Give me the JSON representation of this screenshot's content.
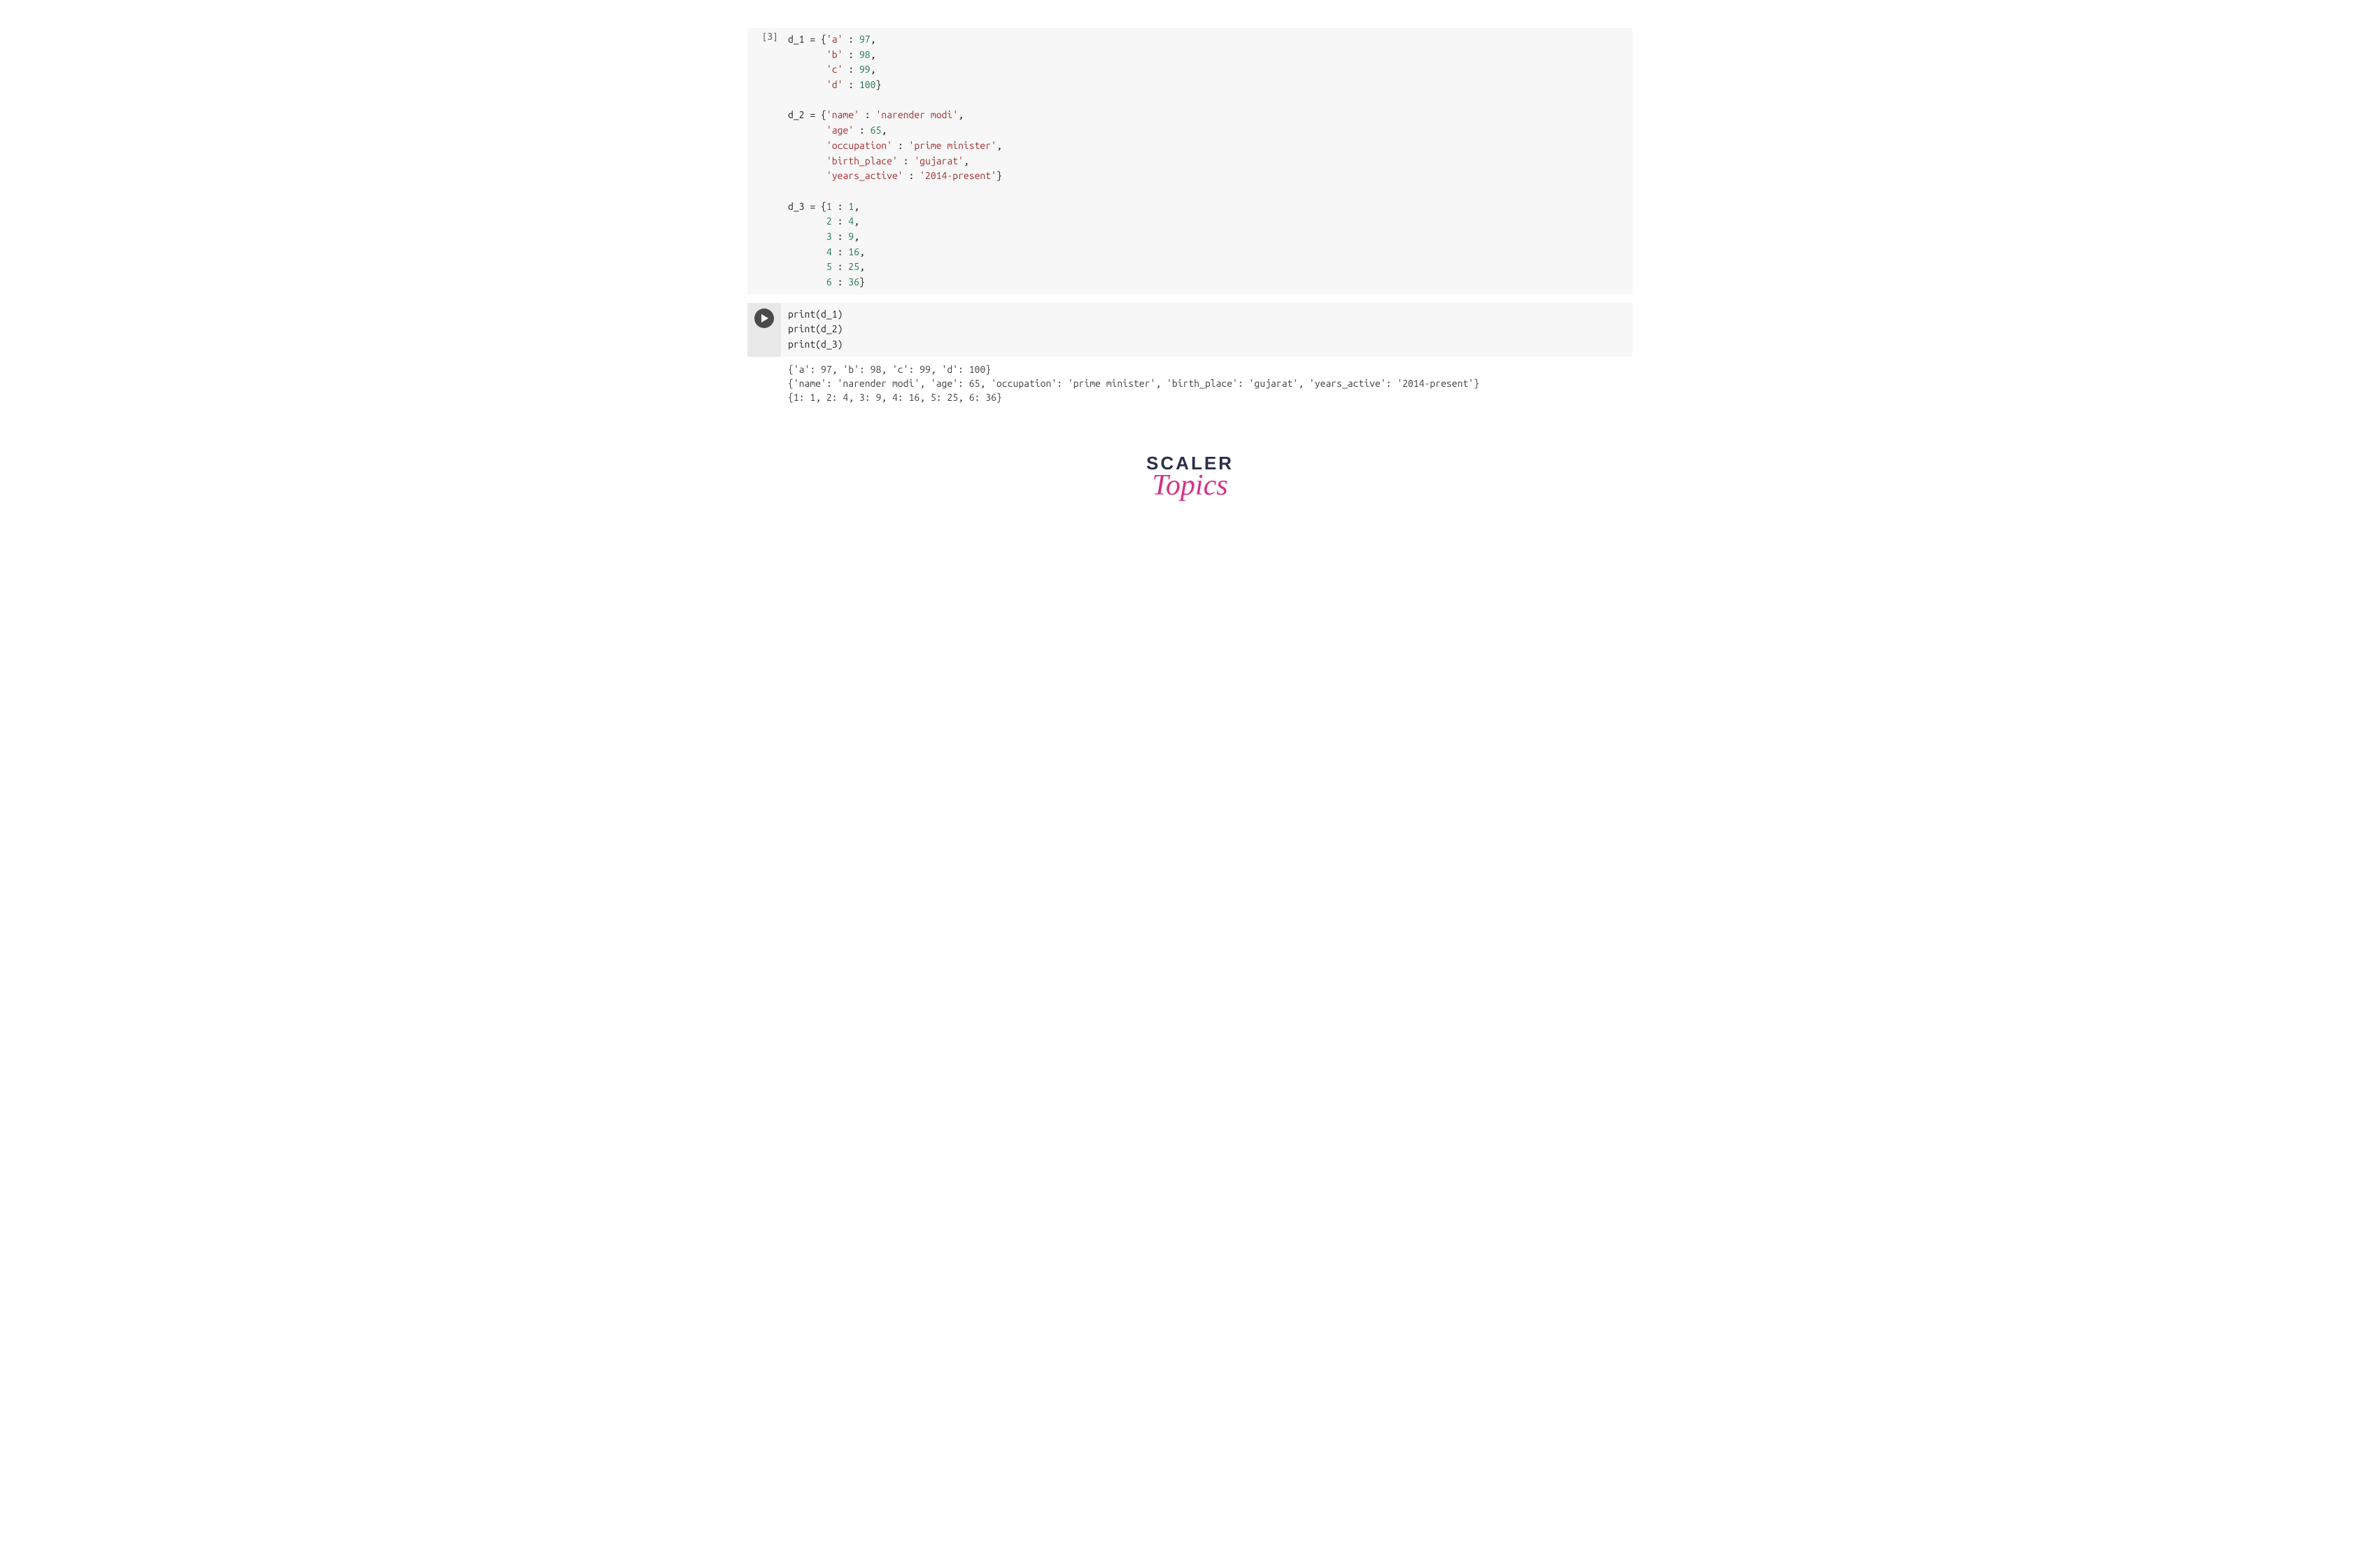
{
  "cell1": {
    "exec_count": "[3]",
    "code": {
      "l1": "d_1 = {",
      "s_a": "'a'",
      "n97": "97",
      "s_b": "'b'",
      "n98": "98",
      "s_c": "'c'",
      "n99": "99",
      "s_d": "'d'",
      "n100": "100",
      "l2": "d_2 = {",
      "s_name": "'name'",
      "v_name": "'narender modi'",
      "s_age": "'age'",
      "n65": "65",
      "s_occ": "'occupation'",
      "v_occ": "'prime minister'",
      "s_bp": "'birth_place'",
      "v_bp": "'gujarat'",
      "s_ya": "'years_active'",
      "v_ya": "'2014-present'",
      "l3": "d_3 = {",
      "n1": "1",
      "n2": "2",
      "n3": "3",
      "n4": "4",
      "n5": "5",
      "n6": "6",
      "n9": "9",
      "n16": "16",
      "n25": "25",
      "n36": "36"
    }
  },
  "cell2": {
    "code": {
      "p1": "print(d_1)",
      "p2": "print(d_2)",
      "p3": "print(d_3)"
    },
    "output": {
      "line1": "{'a': 97, 'b': 98, 'c': 99, 'd': 100}",
      "line2": "{'name': 'narender modi', 'age': 65, 'occupation': 'prime minister', 'birth_place': 'gujarat', 'years_active': '2014-present'}",
      "line3": "{1: 1, 2: 4, 3: 9, 4: 16, 5: 25, 6: 36}"
    }
  },
  "logo": {
    "line1": "SCALER",
    "line2": "Topics"
  }
}
